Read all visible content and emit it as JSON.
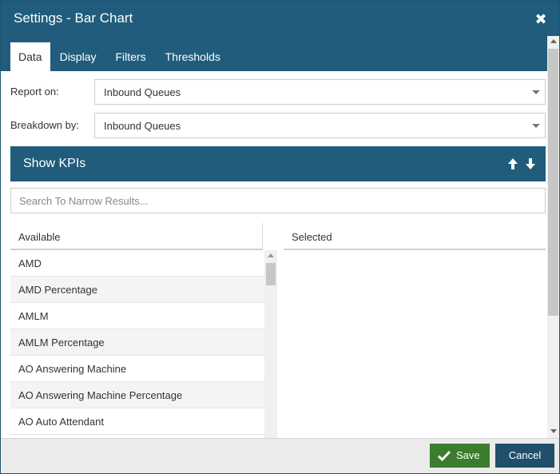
{
  "dialog": {
    "title": "Settings - Bar Chart",
    "close_icon": "close-icon"
  },
  "tabs": [
    {
      "label": "Data",
      "active": true
    },
    {
      "label": "Display",
      "active": false
    },
    {
      "label": "Filters",
      "active": false
    },
    {
      "label": "Thresholds",
      "active": false
    }
  ],
  "fields": {
    "report_on": {
      "label": "Report on:",
      "value": "Inbound Queues"
    },
    "breakdown_by": {
      "label": "Breakdown by:",
      "value": "Inbound Queues"
    }
  },
  "kpi": {
    "title": "Show KPIs",
    "search_placeholder": "Search To Narrow Results...",
    "available_header": "Available",
    "selected_header": "Selected",
    "available_items": [
      "AMD",
      "AMD Percentage",
      "AMLM",
      "AMLM Percentage",
      "AO Answering Machine",
      "AO Answering Machine Percentage",
      "AO Auto Attendant"
    ],
    "selected_items": []
  },
  "footer": {
    "save_label": "Save",
    "cancel_label": "Cancel"
  },
  "colors": {
    "header": "#215c7c",
    "save": "#3a7d2c",
    "cancel": "#1f4f6b"
  }
}
